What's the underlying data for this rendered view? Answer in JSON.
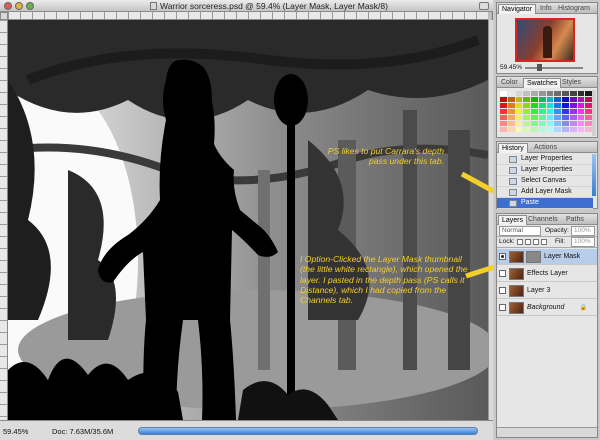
{
  "window": {
    "title": "Warrior sorceress.psd @ 59.4% (Layer Mask, Layer Mask/8)"
  },
  "status": {
    "zoom": "59.45%",
    "doc_size": "Doc: 7.63M/35.6M"
  },
  "annotations": {
    "note_1": "PS likes to put Carrara's depth pass under this tab.",
    "note_2": "I Option-Clicked the Layer Mask thumbnail (the little white rectangle), which opened the layer. I pasted in the depth pass (PS calls it Distance), which I had copied from the Channels tab.",
    "color": "#f3cf2b"
  },
  "navigator": {
    "tabs": [
      "Navigator",
      "Info",
      "Histogram"
    ],
    "zoom": "59.45%"
  },
  "swatches": {
    "tabs": [
      "Color",
      "Swatches",
      "Styles"
    ]
  },
  "history": {
    "tabs": [
      "History",
      "Actions"
    ],
    "items": [
      {
        "label": "Layer Properties"
      },
      {
        "label": "Layer Properties"
      },
      {
        "label": "Select Canvas"
      },
      {
        "label": "Add Layer Mask"
      },
      {
        "label": "Paste"
      }
    ],
    "selected_index": 4
  },
  "layers": {
    "tabs": [
      "Layers",
      "Channels",
      "Paths"
    ],
    "blend_mode": "Normal",
    "opacity_label": "Opacity:",
    "opacity_value": "100%",
    "lock_label": "Lock:",
    "fill_label": "Fill:",
    "fill_value": "100%",
    "items": [
      {
        "name": "Layer Mask",
        "visible": true,
        "selected": true
      },
      {
        "name": "Effects Layer",
        "visible": false,
        "selected": false
      },
      {
        "name": "Layer 3",
        "visible": false,
        "selected": false
      },
      {
        "name": "Background",
        "visible": false,
        "selected": false
      }
    ]
  },
  "colors": {
    "selection": "#3d6fd1",
    "layer_selection": "#b8cdea",
    "scroll_accent": "#3a7fd6"
  }
}
